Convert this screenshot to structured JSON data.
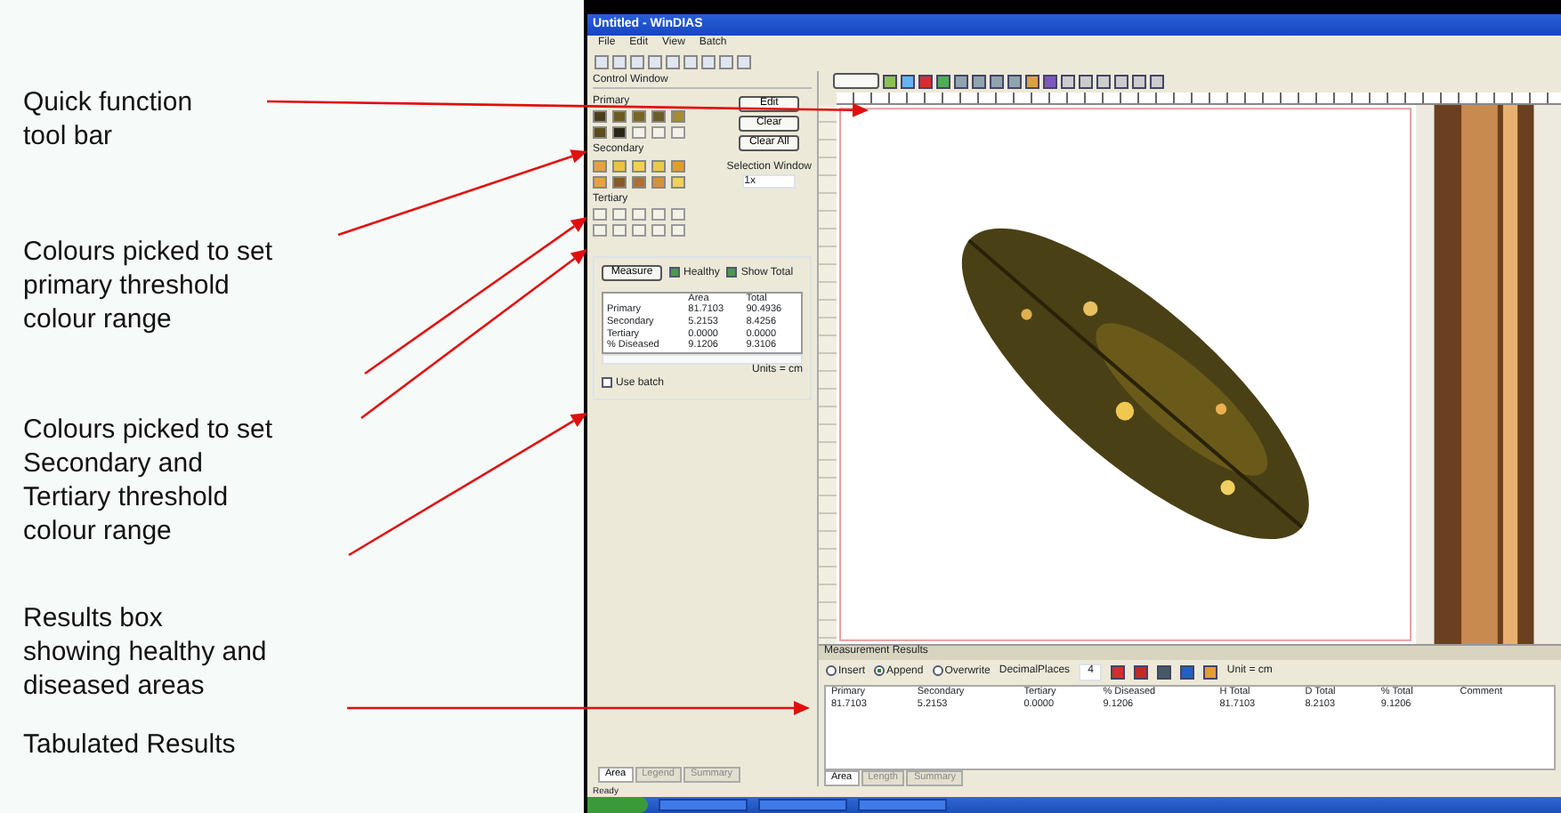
{
  "annotations": [
    {
      "lines": [
        "Quick function",
        "tool bar"
      ]
    },
    {
      "lines": [
        "Colours picked to set",
        "primary threshold",
        "colour range"
      ]
    },
    {
      "lines": [
        "Colours picked to set",
        "Secondary  and",
        "Tertiary threshold",
        "colour range"
      ]
    },
    {
      "lines": [
        "Results box",
        "showing healthy and",
        "diseased areas"
      ]
    },
    {
      "lines": [
        "Tabulated Results"
      ]
    }
  ],
  "window": {
    "title": "Untitled - WinDIAS",
    "menu": [
      "File",
      "Edit",
      "View",
      "Batch"
    ]
  },
  "control_window": {
    "title": "Control Window",
    "groups": [
      {
        "label": "Primary",
        "swatches": [
          {
            "kind": "color",
            "color": "#4a3f1c"
          },
          {
            "kind": "color",
            "color": "#6b5a22"
          },
          {
            "kind": "color",
            "color": "#7a6526"
          },
          {
            "kind": "color",
            "color": "#6d5b2a"
          },
          {
            "kind": "color",
            "color": "#a48a3a"
          },
          {
            "kind": "color",
            "color": "#5c4d1e"
          },
          {
            "kind": "color",
            "color": "#2a2515"
          },
          {
            "kind": "empty"
          },
          {
            "kind": "empty"
          },
          {
            "kind": "empty"
          }
        ]
      },
      {
        "label": "Secondary",
        "swatches": [
          {
            "kind": "color",
            "color": "#e8a23a"
          },
          {
            "kind": "color",
            "color": "#f0c040"
          },
          {
            "kind": "color",
            "color": "#f3d24a"
          },
          {
            "kind": "color",
            "color": "#eec84a"
          },
          {
            "kind": "color",
            "color": "#e89a30"
          },
          {
            "kind": "color",
            "color": "#e8a23a"
          },
          {
            "kind": "color",
            "color": "#8a5a20"
          },
          {
            "kind": "color",
            "color": "#b07030"
          },
          {
            "kind": "color",
            "color": "#d89040"
          },
          {
            "kind": "color",
            "color": "#f0d060"
          }
        ]
      },
      {
        "label": "Tertiary",
        "swatches": [
          {
            "kind": "empty"
          },
          {
            "kind": "empty"
          },
          {
            "kind": "empty"
          },
          {
            "kind": "empty"
          },
          {
            "kind": "empty"
          },
          {
            "kind": "empty"
          },
          {
            "kind": "empty"
          },
          {
            "kind": "empty"
          },
          {
            "kind": "empty"
          },
          {
            "kind": "empty"
          }
        ]
      }
    ],
    "buttons": [
      "Edit",
      "Clear",
      "Clear All"
    ],
    "selection_window": {
      "label": "Selection Window",
      "value": "1x"
    },
    "measure_button": "Measure",
    "checks": [
      {
        "label": "Healthy",
        "checked": true
      },
      {
        "label": "Show Total",
        "checked": true
      }
    ],
    "results": {
      "columns": [
        "",
        "Area",
        "Total"
      ],
      "rows": [
        [
          "Primary",
          "81.7103",
          "90.4936"
        ],
        [
          "Secondary",
          "5.2153",
          "8.4256"
        ],
        [
          "Tertiary",
          "0.0000",
          "0.0000"
        ],
        [
          "% Diseased",
          "9.1206",
          "9.3106"
        ]
      ]
    },
    "units": "Units = cm",
    "use_batch": {
      "label": "Use batch",
      "checked": false
    },
    "tabs": [
      {
        "label": "Area",
        "selected": true
      },
      {
        "label": "Legend",
        "selected": false
      },
      {
        "label": "Summary",
        "selected": false
      }
    ]
  },
  "results_panel": {
    "title": "Measurement Results",
    "modes": [
      {
        "label": "Insert",
        "selected": false
      },
      {
        "label": "Append",
        "selected": true
      },
      {
        "label": "Overwrite",
        "selected": false
      }
    ],
    "decimal_label": "DecimalPlaces",
    "decimal_value": "4",
    "unit": "Unit = cm",
    "columns": [
      "Primary",
      "Secondary",
      "Tertiary",
      "% Diseased",
      "H Total",
      "D Total",
      "% Total",
      "Comment"
    ],
    "rows": [
      [
        "81.7103",
        "5.2153",
        "0.0000",
        "9.1206",
        "81.7103",
        "8.2103",
        "9.1206",
        ""
      ]
    ],
    "tabs": [
      {
        "label": "Area",
        "selected": true
      },
      {
        "label": "Length",
        "selected": false
      },
      {
        "label": "Summary",
        "selected": false
      }
    ]
  },
  "status": "Ready"
}
